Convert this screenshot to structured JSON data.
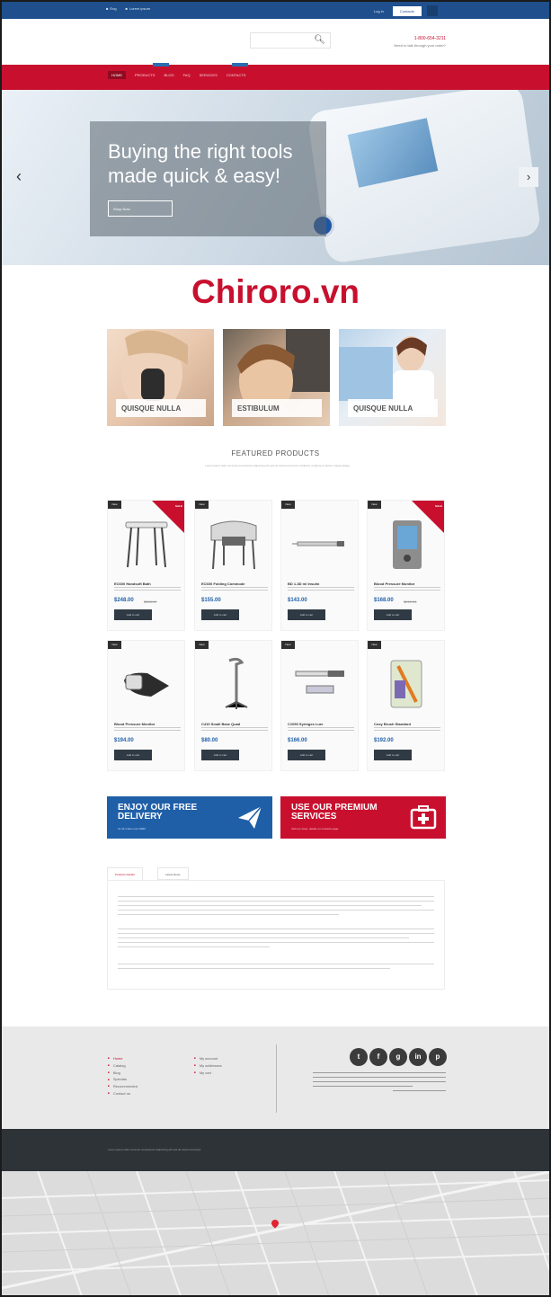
{
  "topbar": {
    "left_links": [
      "Eng",
      "Lorem ipsum"
    ],
    "login_label": "Log in",
    "contact_label": "Contacts"
  },
  "header": {
    "phone": "1-800-654-3211",
    "phone_sub": "Need to talk through your order?"
  },
  "nav": {
    "items": [
      "HOME",
      "PRODUCTS",
      "BLOG",
      "FAQ",
      "SERVICES",
      "CONTACTS"
    ]
  },
  "hero": {
    "title_line1": "Buying the right tools",
    "title_line2": "made quick & easy!",
    "button_label": "Shop Now"
  },
  "brand_watermark": "Chiroro.vn",
  "categories": [
    {
      "label": "QUISQUE NULLA"
    },
    {
      "label": "ESTIBULUM"
    },
    {
      "label": "QUISQUE NULLA"
    }
  ],
  "featured": {
    "title": "FEATURED PRODUCTS",
    "subtitle": "Lorem ipsum dolor sit amet consectetur adipiscing elit sed do eiusmod tempor incididunt ut labore et dolore magna aliqua"
  },
  "products": [
    {
      "badge": "New",
      "sale": "SALE",
      "name": "EC600 Handsoft Bath",
      "price": "$248.00",
      "old_price": "$308.00",
      "cart": "Add to cart"
    },
    {
      "badge": "New",
      "sale": "",
      "name": "EC600 Folding Commode",
      "price": "$155.00",
      "old_price": "",
      "cart": "Add to cart"
    },
    {
      "badge": "New",
      "sale": "",
      "name": "BD 1-3D ml Insulin",
      "price": "$143.00",
      "old_price": "",
      "cart": "Add to cart"
    },
    {
      "badge": "New",
      "sale": "SALE",
      "name": "Blood Pressure Monitor",
      "price": "$168.00",
      "old_price": "$212.00",
      "cart": "Add to cart"
    },
    {
      "badge": "New",
      "sale": "",
      "name": "Blood Pressure Monitor",
      "price": "$194.00",
      "old_price": "",
      "cart": "Add to cart"
    },
    {
      "badge": "New",
      "sale": "",
      "name": "C410 Small Base Quad",
      "price": "$80.00",
      "old_price": "",
      "cart": "Add to cart"
    },
    {
      "badge": "New",
      "sale": "",
      "name": "C1050 Syringes Luer",
      "price": "$166.00",
      "old_price": "",
      "cart": "Add to cart"
    },
    {
      "badge": "New",
      "sale": "",
      "name": "Cosy Brush Standard",
      "price": "$192.00",
      "old_price": "",
      "cart": "Add to cart"
    }
  ],
  "promos": [
    {
      "line1": "ENJOY OUR FREE",
      "line2": "DELIVERY",
      "small": "for all orders over $999",
      "icon": "paper-plane-icon",
      "color": "#1f5fa8"
    },
    {
      "line1": "USE OUR PREMIUM",
      "line2": "SERVICES",
      "small": "Visit our store, details on contacts page",
      "icon": "first-aid-icon",
      "color": "#c8102e"
    }
  ],
  "tabs": [
    "Products Details",
    "Latest News"
  ],
  "footer": {
    "col1": [
      "Home",
      "Catalog",
      "Blog",
      "Specials",
      "Recommended",
      "Contact us"
    ],
    "col2": [
      "My account",
      "My addresses",
      "My cart"
    ],
    "social": [
      "t",
      "f",
      "g",
      "in",
      "p"
    ]
  },
  "copyright": "Lorem ipsum dolor sit amet consectetur adipiscing elit sed do eiusmod tempor"
}
